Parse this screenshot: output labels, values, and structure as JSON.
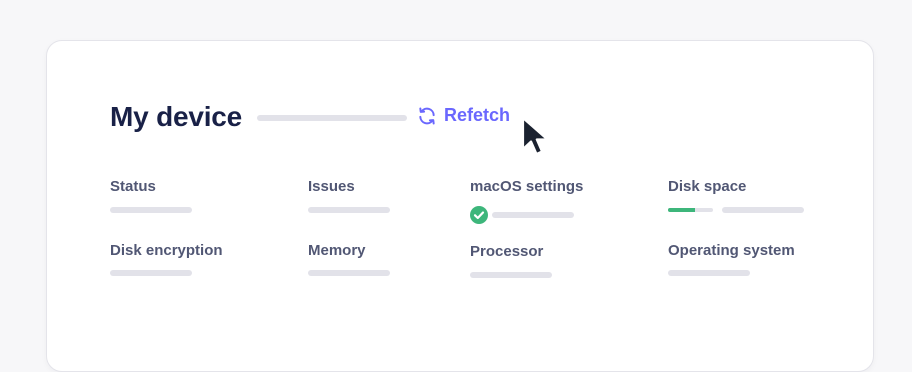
{
  "header": {
    "title": "My device",
    "refetch_label": "Refetch",
    "refetch_icon": "refresh-icon"
  },
  "fields": {
    "status": "Status",
    "issues": "Issues",
    "macos_settings": "macOS settings",
    "disk_space": "Disk space",
    "disk_encryption": "Disk encryption",
    "memory": "Memory",
    "processor": "Processor",
    "operating_system": "Operating system"
  },
  "macos_settings_status_icon": "check-circle-icon",
  "disk_space_used_fraction": 0.6,
  "colors": {
    "accent": "#6a67fe",
    "success": "#3db67b",
    "title": "#192147",
    "label": "#515774",
    "skeleton": "#e2e2e9"
  }
}
